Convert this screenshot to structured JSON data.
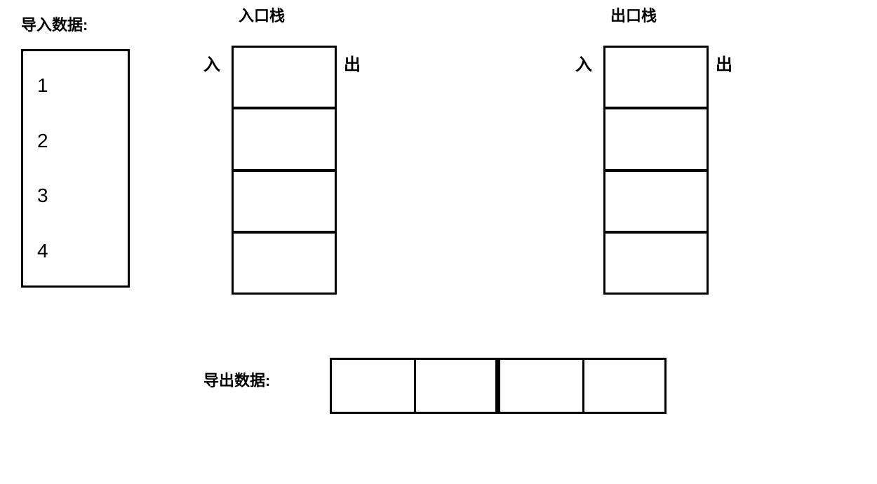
{
  "import_label": "导入数据:",
  "export_label": "导出数据:",
  "entrance_stack_label": "入口栈",
  "exit_stack_label": "出口栈",
  "arrow_in": "入",
  "arrow_out": "出",
  "input_items": [
    "1",
    "2",
    "3",
    "4"
  ],
  "entrance_stack_cells": 4,
  "exit_stack_cells": 4,
  "export_cells": 4
}
